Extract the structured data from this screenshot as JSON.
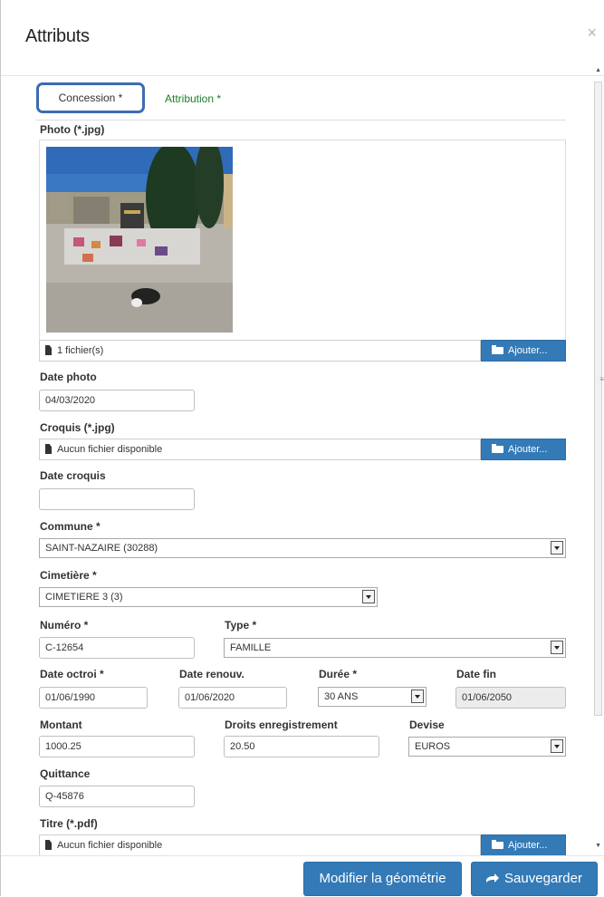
{
  "modal": {
    "title": "Attributs",
    "close_glyph": "×"
  },
  "tabs": [
    {
      "label": "Concession *",
      "active": true
    },
    {
      "label": "Attribution *",
      "active": false
    }
  ],
  "photo": {
    "label": "Photo (*.jpg)",
    "file_count": "1 fichier(s)",
    "add_label": "Ajouter..."
  },
  "date_photo": {
    "label": "Date photo",
    "value": "04/03/2020"
  },
  "croquis": {
    "label": "Croquis (*.jpg)",
    "file_text": "Aucun fichier disponible",
    "add_label": "Ajouter..."
  },
  "date_croquis": {
    "label": "Date croquis",
    "value": ""
  },
  "commune": {
    "label": "Commune *",
    "value": "SAINT-NAZAIRE (30288)"
  },
  "cimetiere": {
    "label": "Cimetière *",
    "value": "CIMETIERE 3 (3)"
  },
  "numero": {
    "label": "Numéro *",
    "value": "C-12654"
  },
  "type": {
    "label": "Type *",
    "value": "FAMILLE"
  },
  "date_octroi": {
    "label": "Date octroi *",
    "value": "01/06/1990"
  },
  "date_renouv": {
    "label": "Date renouv.",
    "value": "01/06/2020"
  },
  "duree": {
    "label": "Durée *",
    "value": "30 ANS"
  },
  "date_fin": {
    "label": "Date fin",
    "value": "01/06/2050"
  },
  "montant": {
    "label": "Montant",
    "value": "1000.25"
  },
  "droits": {
    "label": "Droits enregistrement",
    "value": "20.50"
  },
  "devise": {
    "label": "Devise",
    "value": "EUROS"
  },
  "quittance": {
    "label": "Quittance",
    "value": "Q-45876"
  },
  "titre": {
    "label": "Titre (*.pdf)",
    "file_text": "Aucun fichier disponible",
    "add_label": "Ajouter..."
  },
  "footer": {
    "modify_label": "Modifier la géométrie",
    "save_label": "Sauvegarder"
  },
  "colors": {
    "primary": "#337ab7",
    "active_tab_border": "#3e6bb3",
    "inactive_tab_text": "#1e7a2e"
  },
  "icons": [
    "file-icon",
    "folder-open-icon",
    "arrow-right-icon",
    "close-icon",
    "chevron-down-icon"
  ]
}
